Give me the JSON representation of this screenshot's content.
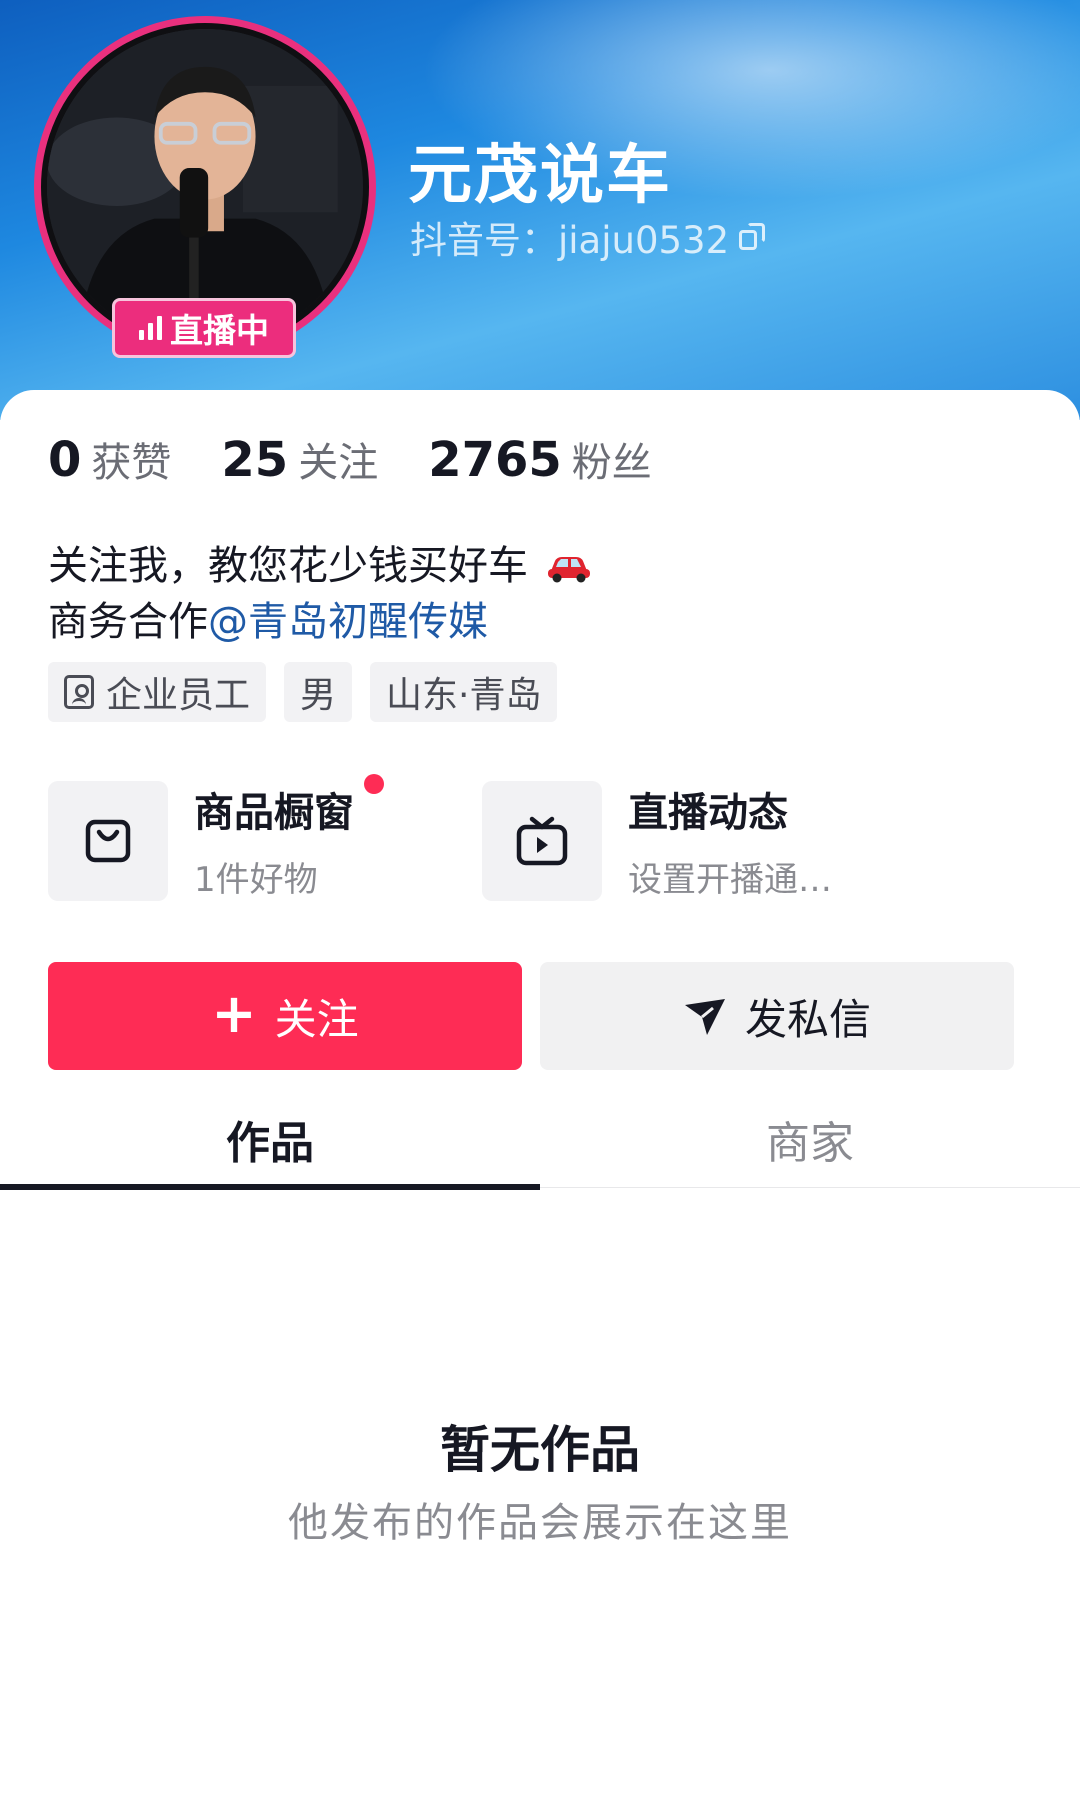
{
  "profile": {
    "nickname": "元茂说车",
    "douyin_id": "抖音号：jiaju0532",
    "live_badge": "直播中"
  },
  "stats": [
    {
      "num": "0",
      "label": "获赞"
    },
    {
      "num": "25",
      "label": "关注"
    },
    {
      "num": "2765",
      "label": "粉丝"
    }
  ],
  "bio": {
    "line1": "关注我，教您花少钱买好车",
    "line2_prefix": "商务合作",
    "line2_mention": "@青岛初醒传媒"
  },
  "tags": [
    "企业员工",
    "男",
    "山东·青岛"
  ],
  "features": [
    {
      "title": "商品橱窗",
      "sub": "1件好物",
      "icon": "shopping-bag-icon"
    },
    {
      "title": "直播动态",
      "sub": "设置开播通…",
      "icon": "live-tv-icon"
    }
  ],
  "buttons": {
    "follow": "关注",
    "message": "发私信"
  },
  "tabs": [
    "作品",
    "商家"
  ],
  "empty": {
    "title": "暂无作品",
    "subtitle": "他发布的作品会展示在这里"
  },
  "colors": {
    "accent": "#fe2c55",
    "live": "#ec2d7d",
    "mention": "#1f5aa6"
  }
}
